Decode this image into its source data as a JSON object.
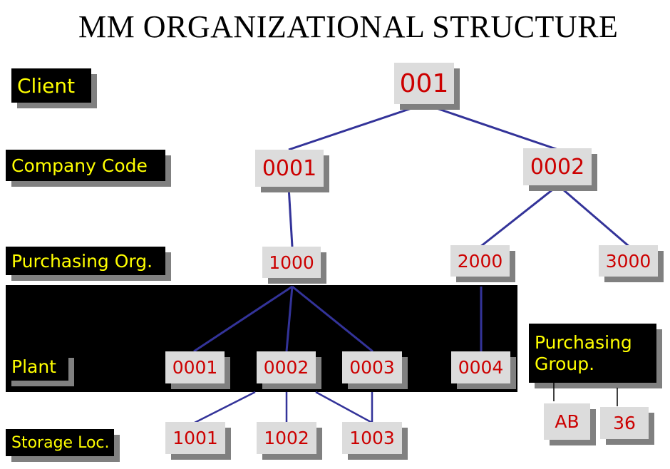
{
  "title": "MM ORGANIZATIONAL STRUCTURE",
  "levels": {
    "client": "Client",
    "company_code": "Company  Code",
    "purchasing_org": "Purchasing Org.",
    "plant": "Plant",
    "storage_loc": "Storage Loc.",
    "purchasing_group": "Purchasing Group."
  },
  "nodes": {
    "client": "001",
    "cc1": "0001",
    "cc2": "0002",
    "po1": "1000",
    "po2": "2000",
    "po3": "3000",
    "pl1": "0001",
    "pl2": "0002",
    "pl3": "0003",
    "pl4": "0004",
    "sl1": "1001",
    "sl2": "1002",
    "sl3": "1003",
    "pg1": "AB",
    "pg2": "36"
  },
  "colors": {
    "label_bg": "#000000",
    "label_text": "#ffff00",
    "node_bg": "#dcdcdc",
    "node_text": "#cc0000",
    "connector": "#333399",
    "shadow": "#808080"
  }
}
